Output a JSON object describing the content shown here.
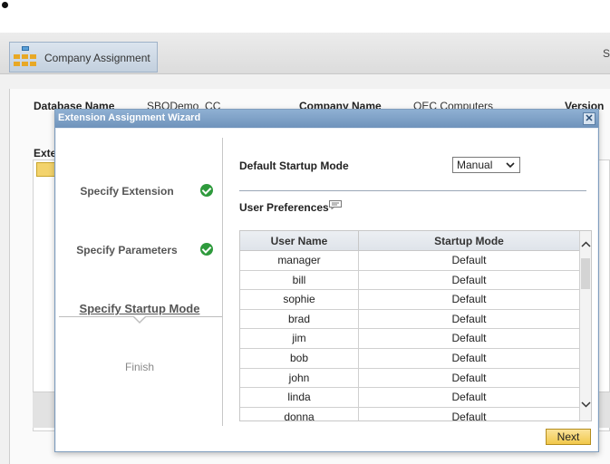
{
  "app": {
    "tab_label": "Company Assignment",
    "right_char": "S",
    "db_label": "Database Name",
    "db_value": "SBODemo_CC",
    "company_label": "Company Name",
    "company_value": "OEC Computers",
    "version_label": "Version",
    "ext_label": "Exte"
  },
  "modal": {
    "title": "Extension Assignment Wizard",
    "close_label": "✕"
  },
  "steps": [
    {
      "label": "Specify Extension",
      "status": "done"
    },
    {
      "label": "Specify Parameters",
      "status": "done"
    },
    {
      "label": "Specify Startup Mode",
      "status": "active"
    },
    {
      "label": "Finish",
      "status": "pending"
    }
  ],
  "form": {
    "default_startup_label": "Default Startup Mode",
    "default_startup_value": "Manual",
    "user_prefs_label": "User Preferences"
  },
  "table": {
    "columns": [
      "User Name",
      "Startup Mode"
    ],
    "rows": [
      {
        "user": "manager",
        "mode": "Default"
      },
      {
        "user": "bill",
        "mode": "Default"
      },
      {
        "user": "sophie",
        "mode": "Default"
      },
      {
        "user": "brad",
        "mode": "Default"
      },
      {
        "user": "jim",
        "mode": "Default"
      },
      {
        "user": "bob",
        "mode": "Default"
      },
      {
        "user": "john",
        "mode": "Default"
      },
      {
        "user": "linda",
        "mode": "Default"
      },
      {
        "user": "donna",
        "mode": "Default"
      }
    ]
  },
  "buttons": {
    "next_label": "Next"
  },
  "colors": {
    "accent_title": "#6f93bb",
    "check_green": "#2e9a3c",
    "next_yellow": "#f1c84b"
  }
}
